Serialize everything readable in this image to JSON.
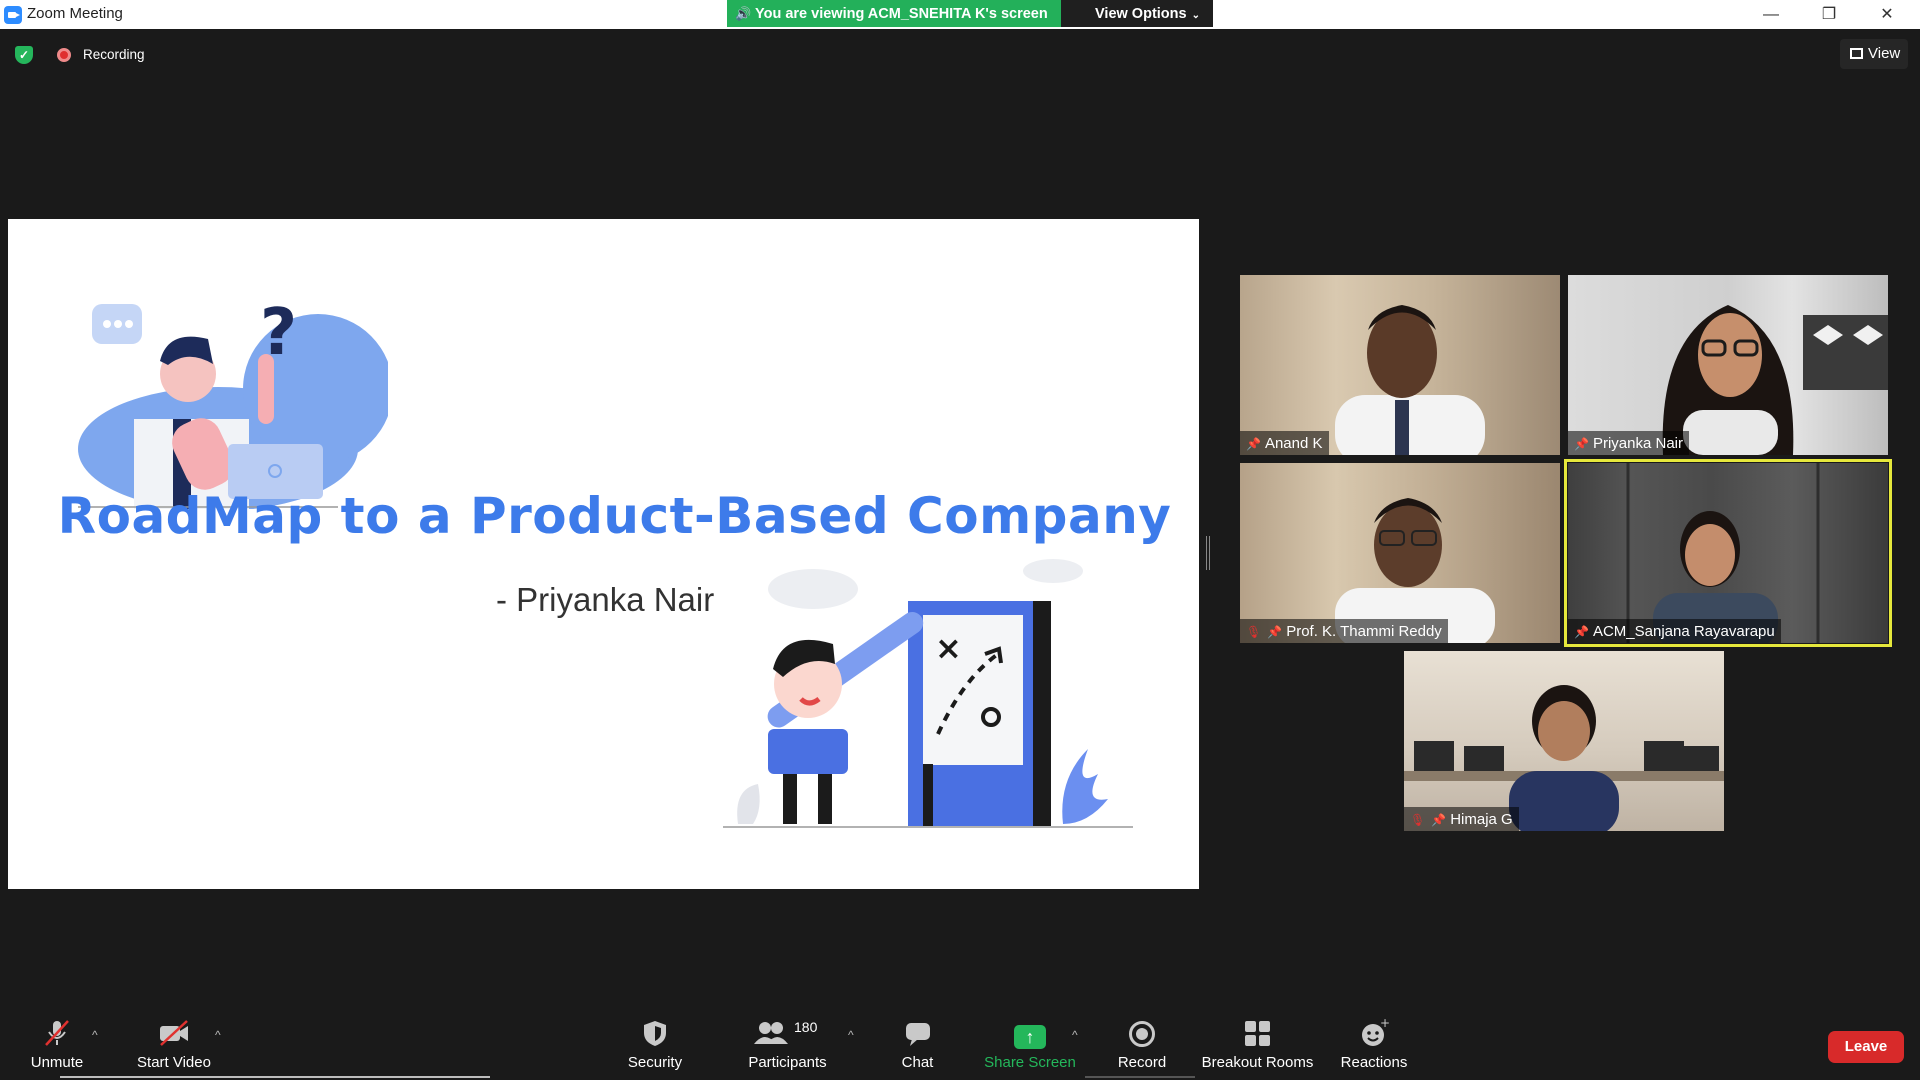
{
  "window": {
    "title": "Zoom Meeting",
    "minimize": "—",
    "maximize": "❐",
    "close": "✕"
  },
  "banner": {
    "viewing": "You are viewing ACM_SNEHITA K's screen",
    "view_options": "View Options"
  },
  "status": {
    "recording": "Recording",
    "view": "View"
  },
  "slide": {
    "title": "RoadMap to a Product-Based Company",
    "subtitle": "- Priyanka Nair"
  },
  "participants_tiles": [
    {
      "name": "Anand K",
      "muted": false
    },
    {
      "name": "Priyanka Nair",
      "muted": false
    },
    {
      "name": "Prof. K. Thammi Reddy",
      "muted": true
    },
    {
      "name": "ACM_Sanjana Rayavarapu",
      "muted": false,
      "active_speaker": true
    },
    {
      "name": "Himaja G",
      "muted": true
    }
  ],
  "toolbar": {
    "unmute": "Unmute",
    "start_video": "Start Video",
    "security": "Security",
    "participants": "Participants",
    "participants_count": "180",
    "chat": "Chat",
    "share_screen": "Share Screen",
    "record": "Record",
    "breakout_rooms": "Breakout Rooms",
    "reactions": "Reactions",
    "leave": "Leave"
  },
  "colors": {
    "share_green": "#24b75b",
    "leave_red": "#d82a2a",
    "slide_title_blue": "#3d7bea",
    "active_speaker": "#e6e83c"
  }
}
